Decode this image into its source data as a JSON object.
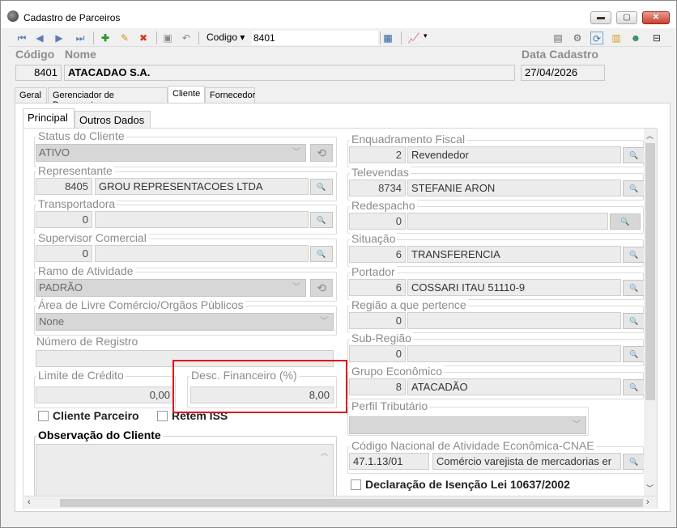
{
  "window": {
    "title": "Cadastro de Parceiros",
    "min": "▬",
    "max": "▢",
    "close": "✕"
  },
  "toolbar": {
    "search_field": "Codigo",
    "search_value": "8401"
  },
  "header": {
    "codigo_label": "Código",
    "nome_label": "Nome",
    "data_label": "Data Cadastro",
    "codigo": "8401",
    "nome": "ATACADAO S.A.",
    "data": "27/04/2026"
  },
  "tabs": [
    "Geral",
    "Gerenciador de Documentos",
    "Cliente",
    "Fornecedor"
  ],
  "subtabs": [
    "Principal",
    "Outros Dados"
  ],
  "left": {
    "status_label": "Status do Cliente",
    "status": "ATIVO",
    "representante_label": "Representante",
    "rep_code": "8405",
    "rep_name": "GROU REPRESENTACOES LTDA",
    "transportadora_label": "Transportadora",
    "transp_code": "0",
    "supervisor_label": "Supervisor Comercial",
    "sup_code": "0",
    "ramo_label": "Ramo de Atividade",
    "ramo": "PADRÃO",
    "area_label": "Área de Livre Comércio/Orgãos Públicos",
    "area": "None",
    "numreg_label": "Número de Registro",
    "limite_label": "Limite de Crédito",
    "limite": "0,00",
    "desc_label": "Desc. Financeiro (%)",
    "desc": "8,00",
    "cliente_parceiro": "Cliente Parceiro",
    "retem_iss": "Retem ISS",
    "obs_label": "Observação do Cliente"
  },
  "right": {
    "enquadramento_label": "Enquadramento Fiscal",
    "enq_code": "2",
    "enq_name": "Revendedor",
    "televendas_label": "Televendas",
    "tel_code": "8734",
    "tel_name": "STEFANIE ARON",
    "redespacho_label": "Redespacho",
    "red_code": "0",
    "situacao_label": "Situação",
    "sit_code": "6",
    "sit_name": "TRANSFERENCIA",
    "portador_label": "Portador",
    "port_code": "6",
    "port_name": "COSSARI ITAU 51110-9",
    "regiao_label": "Região a que pertence",
    "reg_code": "0",
    "subregiao_label": "Sub-Região",
    "sub_code": "0",
    "grupo_label": "Grupo Econômico",
    "grupo_code": "8",
    "grupo_name": "ATACADÃO",
    "perfil_label": "Perfil Tributário",
    "cnae_label": "Código Nacional de Atividade Econômica-CNAE",
    "cnae_code": "47.1.13/01",
    "cnae_desc": "Comércio varejista de mercadorias er",
    "declaracao": "Declaração de Isenção Lei 10637/2002"
  },
  "colors": {
    "highlight": "#e0141b"
  }
}
